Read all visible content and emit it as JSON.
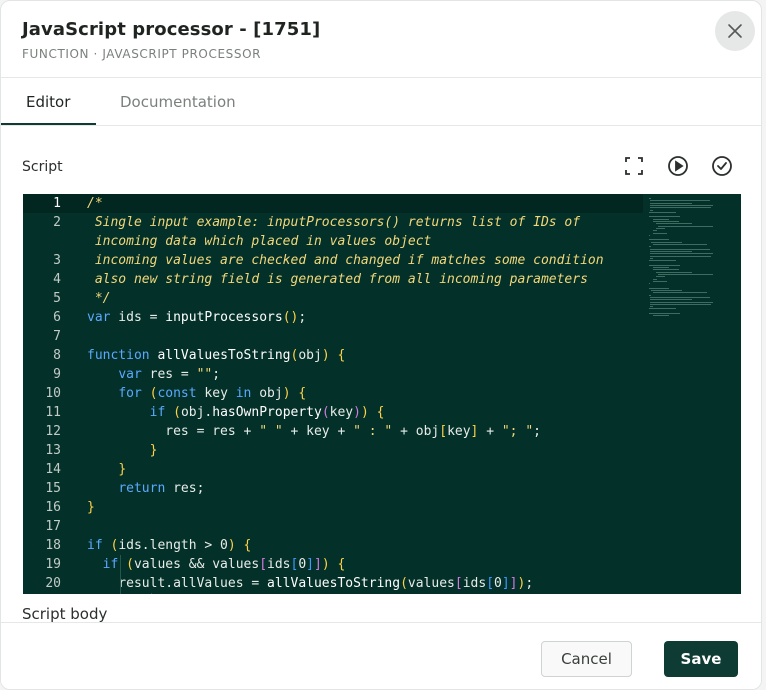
{
  "header": {
    "title": "JavaScript processor - [1751]",
    "subtitle": "FUNCTION · JAVASCRIPT PROCESSOR",
    "close_icon": "close-icon"
  },
  "tabs": [
    {
      "label": "Editor",
      "active": true
    },
    {
      "label": "Documentation",
      "active": false
    }
  ],
  "script": {
    "label": "Script",
    "tools": [
      "fullscreen-icon",
      "play-icon",
      "check-circle-icon"
    ],
    "lines": [
      {
        "n": "1",
        "text": "/*"
      },
      {
        "n": "2",
        "text": " Single input example: inputProcessors() returns list of IDs of"
      },
      {
        "n": "",
        "text": " incoming data which placed in values object"
      },
      {
        "n": "3",
        "text": " incoming values are checked and changed if matches some condition"
      },
      {
        "n": "4",
        "text": " also new string field is generated from all incoming parameters"
      },
      {
        "n": "5",
        "text": " */"
      },
      {
        "n": "6",
        "text": "var ids = inputProcessors();"
      },
      {
        "n": "7",
        "text": ""
      },
      {
        "n": "8",
        "text": "function allValuesToString(obj) {"
      },
      {
        "n": "9",
        "text": "    var res = \"\";"
      },
      {
        "n": "10",
        "text": "    for (const key in obj) {"
      },
      {
        "n": "11",
        "text": "        if (obj.hasOwnProperty(key)) {"
      },
      {
        "n": "12",
        "text": "          res = res + \" \" + key + \" : \" + obj[key] + \"; \";"
      },
      {
        "n": "13",
        "text": "        }"
      },
      {
        "n": "14",
        "text": "    }"
      },
      {
        "n": "15",
        "text": "    return res;"
      },
      {
        "n": "16",
        "text": "}"
      },
      {
        "n": "17",
        "text": ""
      },
      {
        "n": "18",
        "text": "if (ids.length > 0) {"
      },
      {
        "n": "19",
        "text": "  if (values && values[ids[0]]) {"
      },
      {
        "n": "20",
        "text": "    result.allValues = allValuesToString(values[ids[0]]);"
      }
    ]
  },
  "script_body": {
    "label": "Script body"
  },
  "footer": {
    "cancel_label": "Cancel",
    "save_label": "Save"
  },
  "colors": {
    "accent": "#0e3b33",
    "editor_bg": "#033028"
  }
}
